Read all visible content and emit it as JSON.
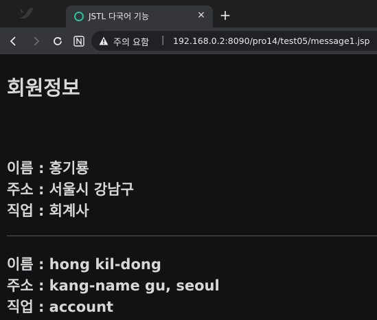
{
  "browser": {
    "tab": {
      "title": "JSTL 다국어 기능",
      "close_label": "×"
    },
    "new_tab_label": "+",
    "address_bar": {
      "security_label": "주의 요함",
      "separator": "|",
      "url": "192.168.0.2:8090/pro14/test05/message1.jsp"
    }
  },
  "page": {
    "heading": "회원정보",
    "sections": [
      {
        "name_line": "이름 : 홍기룡",
        "address_line": "주소 : 서울시 강남구",
        "job_line": "직업 : 회계사"
      },
      {
        "name_line": "이름 : hong kil-dong",
        "address_line": "주소 : kang-name gu, seoul",
        "job_line": "직업 : account"
      }
    ]
  },
  "colors": {
    "page_background": "#121214",
    "text": "#d8d8d8",
    "favicon": "#2fbf9b"
  }
}
